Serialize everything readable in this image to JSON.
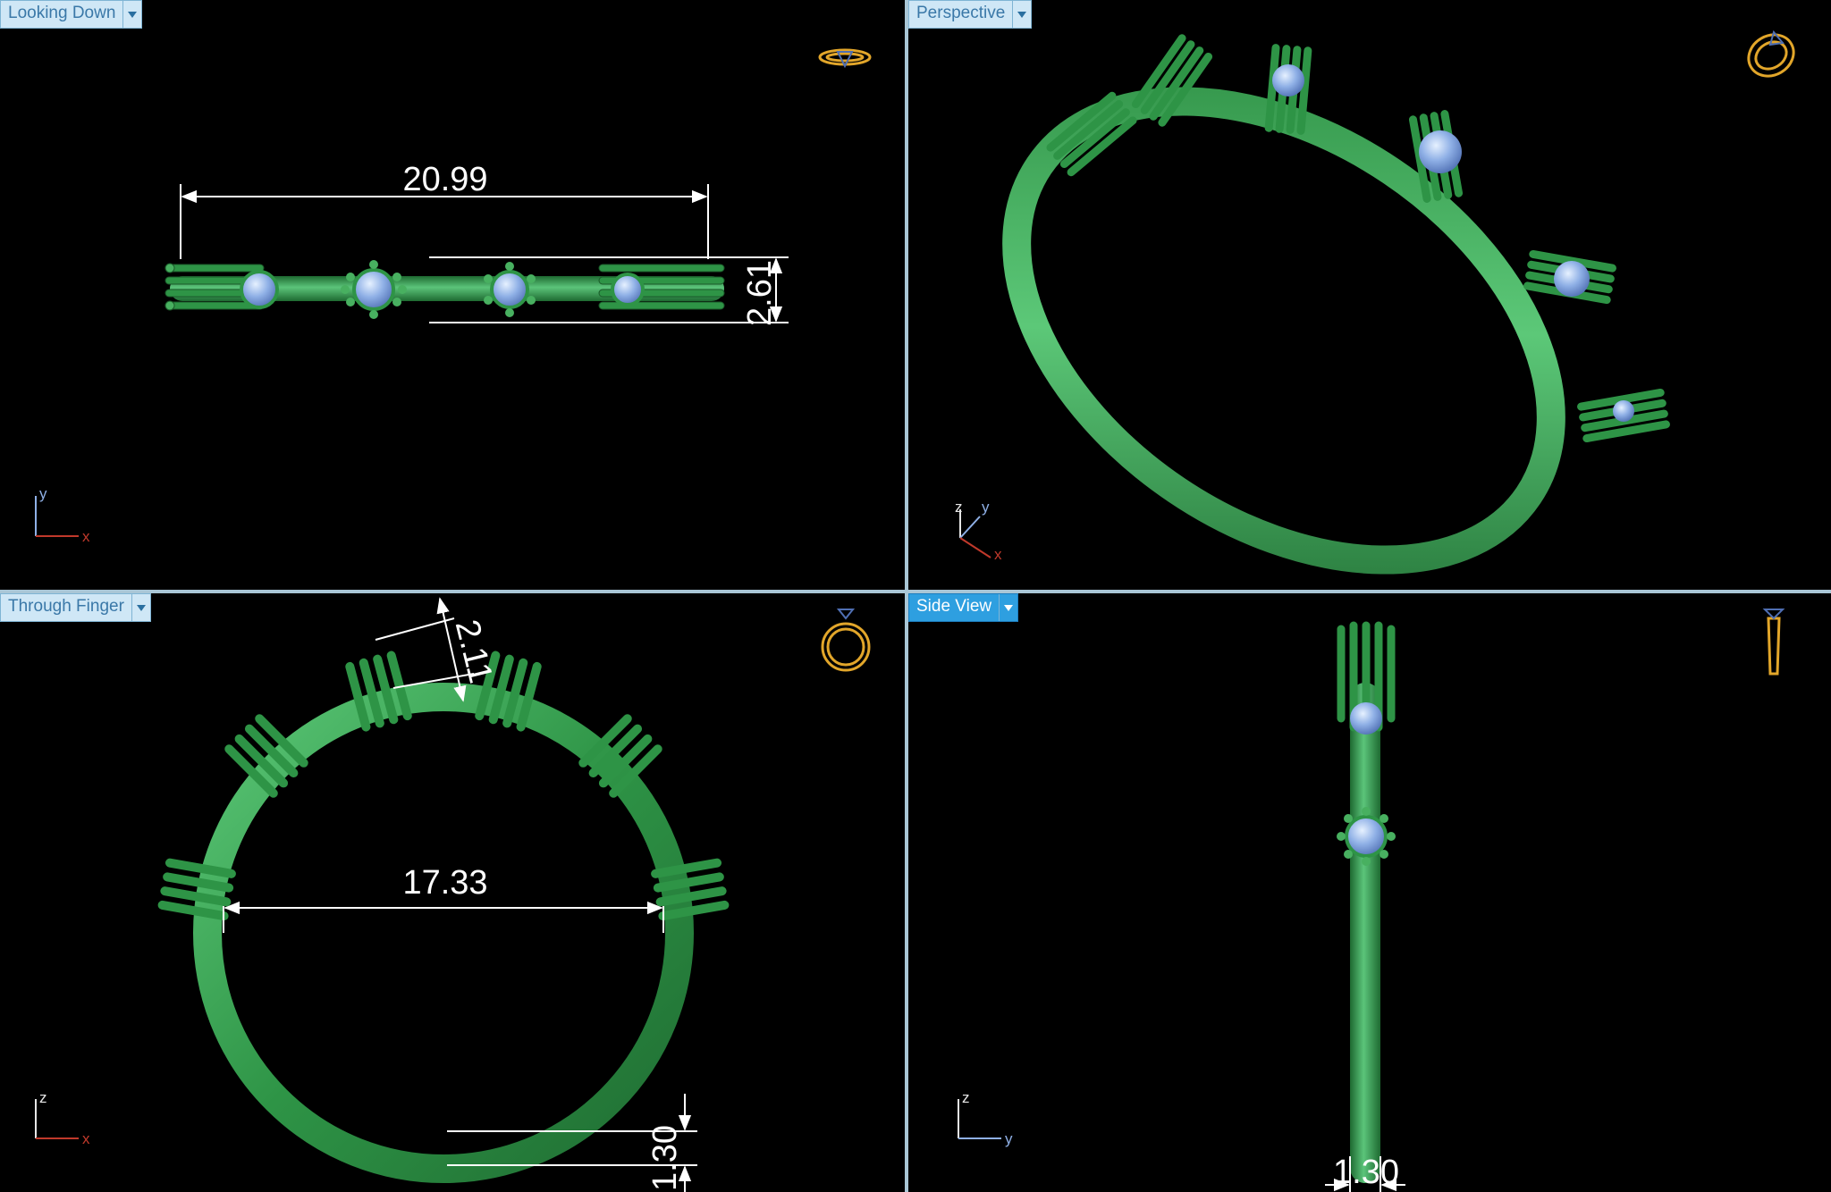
{
  "viewports": {
    "top_left": {
      "label": "Looking Down",
      "dimension_width": "20.99",
      "dimension_height": "2.61",
      "axes": {
        "vertical": "y",
        "horizontal": "x"
      }
    },
    "top_right": {
      "label": "Perspective",
      "axes": {
        "a": "z",
        "b": "y",
        "c": "x"
      }
    },
    "bottom_left": {
      "label": "Through Finger",
      "dimension_diameter": "17.33",
      "dimension_top": "2.11",
      "dimension_bottom": "1.30",
      "axes": {
        "vertical": "z",
        "horizontal": "x"
      }
    },
    "bottom_right": {
      "label": "Side View",
      "dimension_bottom": "1.30",
      "axes": {
        "vertical": "z",
        "horizontal": "y"
      }
    }
  },
  "colors": {
    "metal": "#2e9446",
    "gem": "#8fb0e6",
    "dimension": "#ffffff",
    "active_label": "#2e9fe0",
    "view_cube": "#e2a62a"
  },
  "icons": {
    "viewport_menu": "chevron-down-icon",
    "view_cube": "ring-orientation-icon"
  }
}
